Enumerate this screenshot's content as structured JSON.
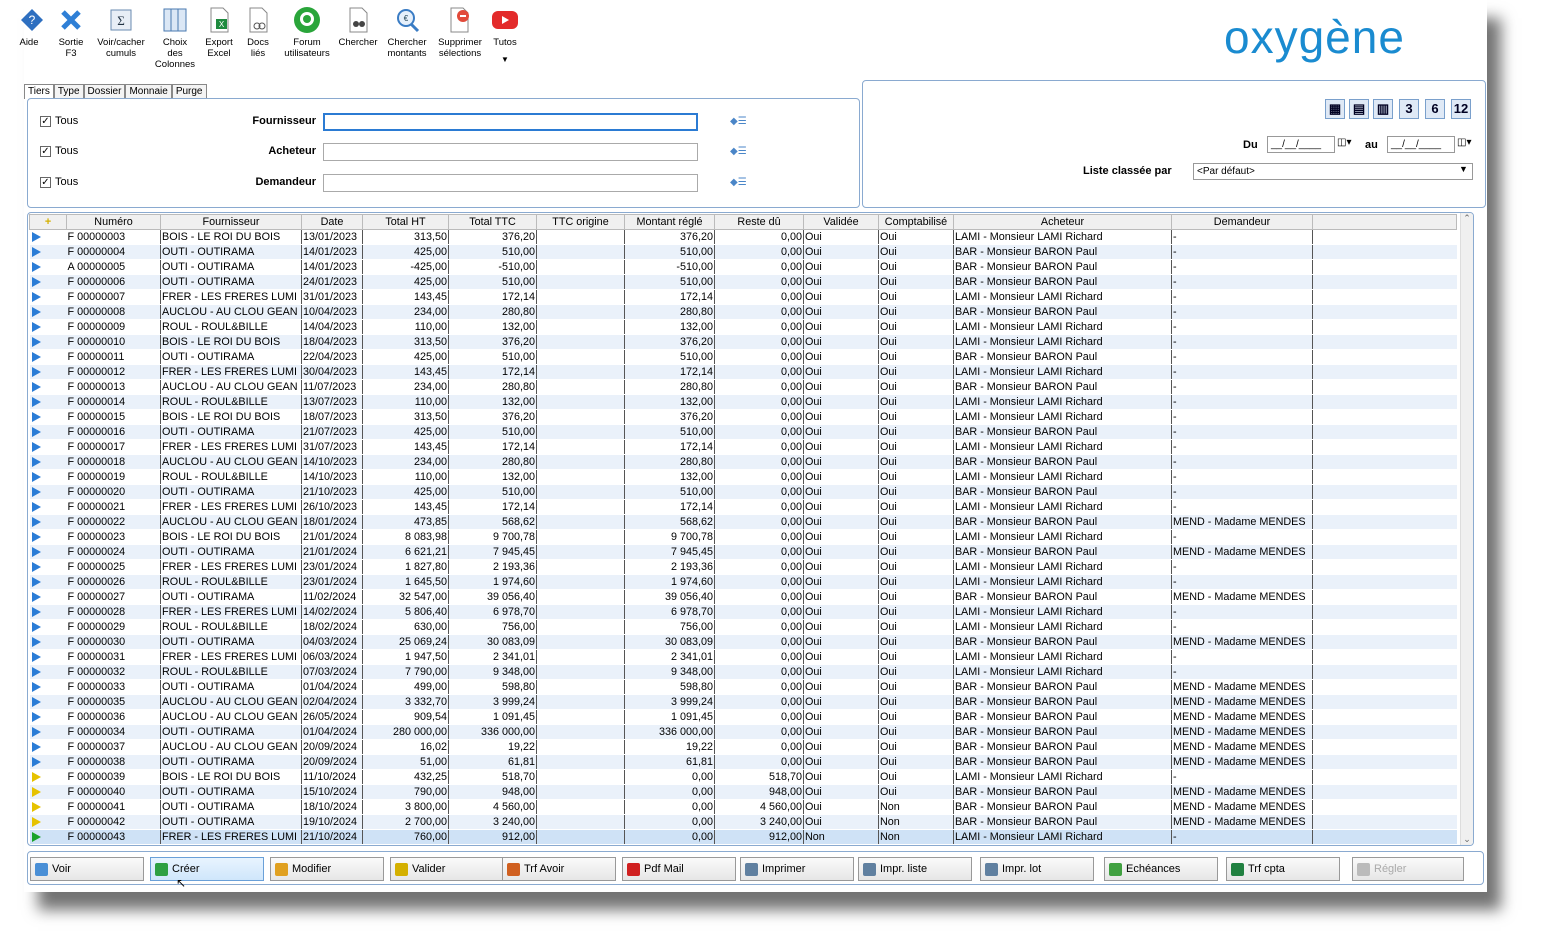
{
  "toolbar": [
    {
      "label": "Aide",
      "icon": "help-icon"
    },
    {
      "label": "Sortie\nF3",
      "icon": "close-icon"
    },
    {
      "label": "Voir/cacher\ncumuls",
      "icon": "sigma-icon"
    },
    {
      "label": "Choix\ndes\nColonnes",
      "icon": "columns-icon"
    },
    {
      "label": "Export\nExcel",
      "icon": "excel-icon"
    },
    {
      "label": "Docs\nliés",
      "icon": "document-link-icon"
    },
    {
      "label": "Forum\nutilisateurs",
      "icon": "forum-icon"
    },
    {
      "label": "Chercher",
      "icon": "binoculars-icon"
    },
    {
      "label": "Chercher\nmontants",
      "icon": "search-amount-icon"
    },
    {
      "label": "Supprimer\nsélections",
      "icon": "eraser-icon"
    },
    {
      "label": "Tutos",
      "icon": "youtube-icon"
    }
  ],
  "logo": "oxygène",
  "tabs": [
    "Tiers",
    "Type",
    "Dossier",
    "Monnaie",
    "Purge"
  ],
  "filters": [
    {
      "check": "Tous",
      "label": "Fournisseur",
      "value": ""
    },
    {
      "check": "Tous",
      "label": "Acheteur",
      "value": ""
    },
    {
      "check": "Tous",
      "label": "Demandeur",
      "value": ""
    }
  ],
  "period_buttons": [
    "3",
    "6",
    "12"
  ],
  "dates": {
    "du_label": "Du",
    "au_label": "au",
    "du": "__/__/____",
    "au": "__/__/____"
  },
  "sort": {
    "label": "Liste classée par",
    "value": "<Par défaut>"
  },
  "columns": [
    "Numéro",
    "Fournisseur",
    "Date",
    "Total HT",
    "Total TTC",
    "TTC origine",
    "Montant réglé",
    "Reste dû",
    "Validée",
    "Comptabilisé",
    "Acheteur",
    "Demandeur"
  ],
  "rows": [
    [
      "b",
      "F 00000003",
      "BOIS - LE ROI DU BOIS",
      "13/01/2023",
      "313,50",
      "376,20",
      "",
      "376,20",
      "0,00",
      "Oui",
      "Oui",
      "LAMI - Monsieur LAMI Richard",
      "-"
    ],
    [
      "b",
      "F 00000004",
      "OUTI - OUTIRAMA",
      "14/01/2023",
      "425,00",
      "510,00",
      "",
      "510,00",
      "0,00",
      "Oui",
      "Oui",
      "BAR - Monsieur BARON Paul",
      "-"
    ],
    [
      "b",
      "A 00000005",
      "OUTI - OUTIRAMA",
      "14/01/2023",
      "-425,00",
      "-510,00",
      "",
      "-510,00",
      "0,00",
      "Oui",
      "Oui",
      "BAR - Monsieur BARON Paul",
      "-"
    ],
    [
      "b",
      "F 00000006",
      "OUTI - OUTIRAMA",
      "24/01/2023",
      "425,00",
      "510,00",
      "",
      "510,00",
      "0,00",
      "Oui",
      "Oui",
      "BAR - Monsieur BARON Paul",
      "-"
    ],
    [
      "b",
      "F 00000007",
      "FRER - LES FRERES LUMI",
      "31/01/2023",
      "143,45",
      "172,14",
      "",
      "172,14",
      "0,00",
      "Oui",
      "Oui",
      "LAMI - Monsieur LAMI Richard",
      "-"
    ],
    [
      "b",
      "F 00000008",
      "AUCLOU - AU CLOU GEAN",
      "10/04/2023",
      "234,00",
      "280,80",
      "",
      "280,80",
      "0,00",
      "Oui",
      "Oui",
      "BAR - Monsieur BARON Paul",
      "-"
    ],
    [
      "b",
      "F 00000009",
      "ROUL - ROUL&BILLE",
      "14/04/2023",
      "110,00",
      "132,00",
      "",
      "132,00",
      "0,00",
      "Oui",
      "Oui",
      "LAMI - Monsieur LAMI Richard",
      "-"
    ],
    [
      "b",
      "F 00000010",
      "BOIS - LE ROI DU BOIS",
      "18/04/2023",
      "313,50",
      "376,20",
      "",
      "376,20",
      "0,00",
      "Oui",
      "Oui",
      "LAMI - Monsieur LAMI Richard",
      "-"
    ],
    [
      "b",
      "F 00000011",
      "OUTI - OUTIRAMA",
      "22/04/2023",
      "425,00",
      "510,00",
      "",
      "510,00",
      "0,00",
      "Oui",
      "Oui",
      "BAR - Monsieur BARON Paul",
      "-"
    ],
    [
      "b",
      "F 00000012",
      "FRER - LES FRERES LUMI",
      "30/04/2023",
      "143,45",
      "172,14",
      "",
      "172,14",
      "0,00",
      "Oui",
      "Oui",
      "LAMI - Monsieur LAMI Richard",
      "-"
    ],
    [
      "b",
      "F 00000013",
      "AUCLOU - AU CLOU GEAN",
      "11/07/2023",
      "234,00",
      "280,80",
      "",
      "280,80",
      "0,00",
      "Oui",
      "Oui",
      "BAR - Monsieur BARON Paul",
      "-"
    ],
    [
      "b",
      "F 00000014",
      "ROUL - ROUL&BILLE",
      "13/07/2023",
      "110,00",
      "132,00",
      "",
      "132,00",
      "0,00",
      "Oui",
      "Oui",
      "LAMI - Monsieur LAMI Richard",
      "-"
    ],
    [
      "b",
      "F 00000015",
      "BOIS - LE ROI DU BOIS",
      "18/07/2023",
      "313,50",
      "376,20",
      "",
      "376,20",
      "0,00",
      "Oui",
      "Oui",
      "LAMI - Monsieur LAMI Richard",
      "-"
    ],
    [
      "b",
      "F 00000016",
      "OUTI - OUTIRAMA",
      "21/07/2023",
      "425,00",
      "510,00",
      "",
      "510,00",
      "0,00",
      "Oui",
      "Oui",
      "BAR - Monsieur BARON Paul",
      "-"
    ],
    [
      "b",
      "F 00000017",
      "FRER - LES FRERES LUMI",
      "31/07/2023",
      "143,45",
      "172,14",
      "",
      "172,14",
      "0,00",
      "Oui",
      "Oui",
      "LAMI - Monsieur LAMI Richard",
      "-"
    ],
    [
      "b",
      "F 00000018",
      "AUCLOU - AU CLOU GEAN",
      "14/10/2023",
      "234,00",
      "280,80",
      "",
      "280,80",
      "0,00",
      "Oui",
      "Oui",
      "BAR - Monsieur BARON Paul",
      "-"
    ],
    [
      "b",
      "F 00000019",
      "ROUL - ROUL&BILLE",
      "14/10/2023",
      "110,00",
      "132,00",
      "",
      "132,00",
      "0,00",
      "Oui",
      "Oui",
      "LAMI - Monsieur LAMI Richard",
      "-"
    ],
    [
      "b",
      "F 00000020",
      "OUTI - OUTIRAMA",
      "21/10/2023",
      "425,00",
      "510,00",
      "",
      "510,00",
      "0,00",
      "Oui",
      "Oui",
      "BAR - Monsieur BARON Paul",
      "-"
    ],
    [
      "b",
      "F 00000021",
      "FRER - LES FRERES LUMI",
      "26/10/2023",
      "143,45",
      "172,14",
      "",
      "172,14",
      "0,00",
      "Oui",
      "Oui",
      "LAMI - Monsieur LAMI Richard",
      "-"
    ],
    [
      "b",
      "F 00000022",
      "AUCLOU - AU CLOU GEAN",
      "18/01/2024",
      "473,85",
      "568,62",
      "",
      "568,62",
      "0,00",
      "Oui",
      "Oui",
      "BAR - Monsieur BARON Paul",
      "MEND - Madame MENDES"
    ],
    [
      "b",
      "F 00000023",
      "BOIS - LE ROI DU BOIS",
      "21/01/2024",
      "8 083,98",
      "9 700,78",
      "",
      "9 700,78",
      "0,00",
      "Oui",
      "Oui",
      "LAMI - Monsieur LAMI Richard",
      "-"
    ],
    [
      "b",
      "F 00000024",
      "OUTI - OUTIRAMA",
      "21/01/2024",
      "6 621,21",
      "7 945,45",
      "",
      "7 945,45",
      "0,00",
      "Oui",
      "Oui",
      "BAR - Monsieur BARON Paul",
      "MEND - Madame MENDES"
    ],
    [
      "b",
      "F 00000025",
      "FRER - LES FRERES LUMI",
      "23/01/2024",
      "1 827,80",
      "2 193,36",
      "",
      "2 193,36",
      "0,00",
      "Oui",
      "Oui",
      "LAMI - Monsieur LAMI Richard",
      "-"
    ],
    [
      "b",
      "F 00000026",
      "ROUL - ROUL&BILLE",
      "23/01/2024",
      "1 645,50",
      "1 974,60",
      "",
      "1 974,60",
      "0,00",
      "Oui",
      "Oui",
      "LAMI - Monsieur LAMI Richard",
      "-"
    ],
    [
      "b",
      "F 00000027",
      "OUTI - OUTIRAMA",
      "11/02/2024",
      "32 547,00",
      "39 056,40",
      "",
      "39 056,40",
      "0,00",
      "Oui",
      "Oui",
      "BAR - Monsieur BARON Paul",
      "MEND - Madame MENDES"
    ],
    [
      "b",
      "F 00000028",
      "FRER - LES FRERES LUMI",
      "14/02/2024",
      "5 806,40",
      "6 978,70",
      "",
      "6 978,70",
      "0,00",
      "Oui",
      "Oui",
      "LAMI - Monsieur LAMI Richard",
      "-"
    ],
    [
      "b",
      "F 00000029",
      "ROUL - ROUL&BILLE",
      "18/02/2024",
      "630,00",
      "756,00",
      "",
      "756,00",
      "0,00",
      "Oui",
      "Oui",
      "LAMI - Monsieur LAMI Richard",
      "-"
    ],
    [
      "b",
      "F 00000030",
      "OUTI - OUTIRAMA",
      "04/03/2024",
      "25 069,24",
      "30 083,09",
      "",
      "30 083,09",
      "0,00",
      "Oui",
      "Oui",
      "BAR - Monsieur BARON Paul",
      "MEND - Madame MENDES"
    ],
    [
      "b",
      "F 00000031",
      "FRER - LES FRERES LUMI",
      "06/03/2024",
      "1 947,50",
      "2 341,01",
      "",
      "2 341,01",
      "0,00",
      "Oui",
      "Oui",
      "LAMI - Monsieur LAMI Richard",
      "-"
    ],
    [
      "b",
      "F 00000032",
      "ROUL - ROUL&BILLE",
      "07/03/2024",
      "7 790,00",
      "9 348,00",
      "",
      "9 348,00",
      "0,00",
      "Oui",
      "Oui",
      "LAMI - Monsieur LAMI Richard",
      "-"
    ],
    [
      "b",
      "F 00000033",
      "OUTI - OUTIRAMA",
      "01/04/2024",
      "499,00",
      "598,80",
      "",
      "598,80",
      "0,00",
      "Oui",
      "Oui",
      "BAR - Monsieur BARON Paul",
      "MEND - Madame MENDES"
    ],
    [
      "b",
      "F 00000035",
      "AUCLOU - AU CLOU GEAN",
      "02/04/2024",
      "3 332,70",
      "3 999,24",
      "",
      "3 999,24",
      "0,00",
      "Oui",
      "Oui",
      "BAR - Monsieur BARON Paul",
      "MEND - Madame MENDES"
    ],
    [
      "b",
      "F 00000036",
      "AUCLOU - AU CLOU GEAN",
      "26/05/2024",
      "909,54",
      "1 091,45",
      "",
      "1 091,45",
      "0,00",
      "Oui",
      "Oui",
      "BAR - Monsieur BARON Paul",
      "MEND - Madame MENDES"
    ],
    [
      "b",
      "F 00000034",
      "OUTI - OUTIRAMA",
      "01/04/2024",
      "280 000,00",
      "336 000,00",
      "",
      "336 000,00",
      "0,00",
      "Oui",
      "Oui",
      "BAR - Monsieur BARON Paul",
      "MEND - Madame MENDES"
    ],
    [
      "b",
      "F 00000037",
      "AUCLOU - AU CLOU GEAN",
      "20/09/2024",
      "16,02",
      "19,22",
      "",
      "19,22",
      "0,00",
      "Oui",
      "Oui",
      "BAR - Monsieur BARON Paul",
      "MEND - Madame MENDES"
    ],
    [
      "b",
      "F 00000038",
      "OUTI - OUTIRAMA",
      "20/09/2024",
      "51,00",
      "61,81",
      "",
      "61,81",
      "0,00",
      "Oui",
      "Oui",
      "BAR - Monsieur BARON Paul",
      "MEND - Madame MENDES"
    ],
    [
      "y",
      "F 00000039",
      "BOIS - LE ROI DU BOIS",
      "11/10/2024",
      "432,25",
      "518,70",
      "",
      "0,00",
      "518,70",
      "Oui",
      "Oui",
      "LAMI - Monsieur LAMI Richard",
      "-"
    ],
    [
      "y",
      "F 00000040",
      "OUTI - OUTIRAMA",
      "15/10/2024",
      "790,00",
      "948,00",
      "",
      "0,00",
      "948,00",
      "Oui",
      "Oui",
      "BAR - Monsieur BARON Paul",
      "MEND - Madame MENDES"
    ],
    [
      "y",
      "F 00000041",
      "OUTI - OUTIRAMA",
      "18/10/2024",
      "3 800,00",
      "4 560,00",
      "",
      "0,00",
      "4 560,00",
      "Oui",
      "Non",
      "BAR - Monsieur BARON Paul",
      "MEND - Madame MENDES"
    ],
    [
      "y",
      "F 00000042",
      "OUTI - OUTIRAMA",
      "19/10/2024",
      "2 700,00",
      "3 240,00",
      "",
      "0,00",
      "3 240,00",
      "Oui",
      "Non",
      "BAR - Monsieur BARON Paul",
      "MEND - Madame MENDES"
    ],
    [
      "g",
      "F 00000043",
      "FRER - LES FRERES LUMI",
      "21/10/2024",
      "760,00",
      "912,00",
      "",
      "0,00",
      "912,00",
      "Non",
      "Non",
      "LAMI - Monsieur LAMI Richard",
      "-"
    ]
  ],
  "buttons": [
    {
      "label": "Voir",
      "icon": "view-icon",
      "color": "#4a8fd6"
    },
    {
      "label": "Créer",
      "icon": "add-icon",
      "color": "#2ea043"
    },
    {
      "label": "Modifier",
      "icon": "pencil-icon",
      "color": "#e0a020"
    },
    {
      "label": "Valider",
      "icon": "validate-icon",
      "color": "#d4b000"
    },
    {
      "label": "Trf Avoir",
      "icon": "transfer-credit-icon",
      "color": "#d06020"
    },
    {
      "label": "Pdf Mail",
      "icon": "pdf-icon",
      "color": "#d02020"
    },
    {
      "label": "Imprimer",
      "icon": "printer-icon",
      "color": "#6080a0"
    },
    {
      "label": "Impr. liste",
      "icon": "print-list-icon",
      "color": "#6080a0"
    },
    {
      "label": "Impr. lot",
      "icon": "print-batch-icon",
      "color": "#6080a0"
    },
    {
      "label": "Echéances",
      "icon": "calendar-icon",
      "color": "#40a040"
    },
    {
      "label": "Trf cpta",
      "icon": "accounting-transfer-icon",
      "color": "#208040"
    },
    {
      "label": "Régler",
      "icon": "pay-icon",
      "color": "#bbbbbb"
    }
  ]
}
